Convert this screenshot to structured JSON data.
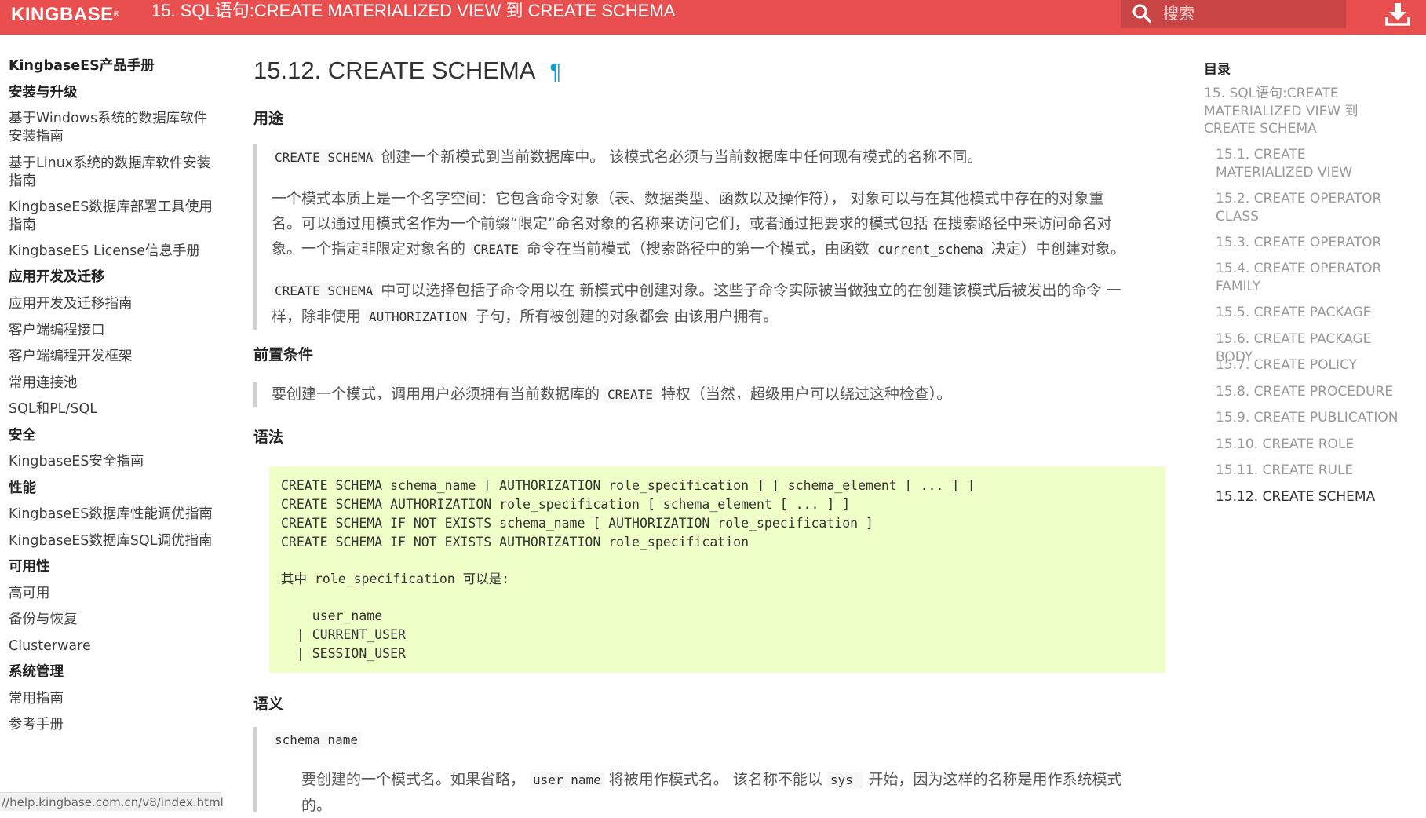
{
  "topbar": {
    "logo": "KINGBASE",
    "logo_mark": "®",
    "title": "15. SQL语句:CREATE MATERIALIZED VIEW 到 CREATE SCHEMA",
    "search_placeholder": "搜索"
  },
  "sidebar": {
    "items": [
      {
        "label": "KingbaseES产品手册",
        "heading": true
      },
      {
        "label": "安装与升级",
        "heading": true
      },
      {
        "label": "基于Windows系统的数据库软件安装指南",
        "heading": false
      },
      {
        "label": "基于Linux系统的数据库软件安装指南",
        "heading": false
      },
      {
        "label": "KingbaseES数据库部署工具使用指南",
        "heading": false
      },
      {
        "label": "KingbaseES License信息手册",
        "heading": false
      },
      {
        "label": "应用开发及迁移",
        "heading": true
      },
      {
        "label": "应用开发及迁移指南",
        "heading": false
      },
      {
        "label": "客户端编程接口",
        "heading": false
      },
      {
        "label": "客户端编程开发框架",
        "heading": false
      },
      {
        "label": "常用连接池",
        "heading": false
      },
      {
        "label": "SQL和PL/SQL",
        "heading": false
      },
      {
        "label": "安全",
        "heading": true
      },
      {
        "label": "KingbaseES安全指南",
        "heading": false
      },
      {
        "label": "性能",
        "heading": true
      },
      {
        "label": "KingbaseES数据库性能调优指南",
        "heading": false
      },
      {
        "label": "KingbaseES数据库SQL调优指南",
        "heading": false
      },
      {
        "label": "可用性",
        "heading": true
      },
      {
        "label": "高可用",
        "heading": false
      },
      {
        "label": "备份与恢复",
        "heading": false
      },
      {
        "label": "Clusterware",
        "heading": false
      },
      {
        "label": "系统管理",
        "heading": true
      },
      {
        "label": "常用指南",
        "heading": false
      },
      {
        "label": "参考手册",
        "heading": false
      }
    ]
  },
  "status_url": "//help.kingbase.com.cn/v8/index.html",
  "main": {
    "title": "15.12. CREATE SCHEMA",
    "anchor": "¶",
    "purpose": {
      "heading": "用途",
      "p1": {
        "code": "CREATE SCHEMA",
        "text": " 创建一个新模式到当前数据库中。 该模式名必须与当前数据库中任何现有模式的名称不同。"
      },
      "p2": {
        "line1": "一个模式本质上是一个名字空间：它包含命令对象（表、数据类型、函数以及操作符）， 对象可以与在其他模式中存在的对象重",
        "line2": "名。可以通过用模式名作为一个前缀“限定”命名对象的名称来访问它们，或者通过把要求的模式包括 在搜索路径中来访问命名对",
        "l3a": "象。一个指定非限定对象名的 ",
        "l3code1": "CREATE",
        "l3b": " 命令在当前模式（搜索路径中的第一个模式，由函数 ",
        "l3code2": "current_schema",
        "l3c": " 决定）中创建对象。"
      },
      "p3": {
        "code1": "CREATE SCHEMA",
        "l1": " 中可以选择包括子命令用以在 新模式中创建对象。这些子命令实际被当做独立的在创建该模式后被发出的命令 一",
        "l2a": "样，除非使用 ",
        "code2": "AUTHORIZATION",
        "l2b": " 子句，所有被创建的对象都会 由该用户拥有。"
      }
    },
    "prereq": {
      "heading": "前置条件",
      "a": "要创建一个模式，调用用户必须拥有当前数据库的 ",
      "code": "CREATE",
      "b": " 特权（当然，超级用户可以绕过这种检查）。"
    },
    "syntax": {
      "heading": "语法",
      "lines": [
        "CREATE SCHEMA schema_name [ AUTHORIZATION role_specification ] [ schema_element [ ... ] ]",
        "CREATE SCHEMA AUTHORIZATION role_specification [ schema_element [ ... ] ]",
        "CREATE SCHEMA IF NOT EXISTS schema_name [ AUTHORIZATION role_specification ]",
        "CREATE SCHEMA IF NOT EXISTS AUTHORIZATION role_specification",
        "",
        "其中 role_specification 可以是:",
        "",
        "    user_name",
        "  | CURRENT_USER",
        "  | SESSION_USER"
      ]
    },
    "semantics": {
      "heading": "语义",
      "term": "schema_name",
      "a": "要创建的一个模式名。如果省略， ",
      "code1": "user_name",
      "b": " 将被用作模式名。 该名称不能以 ",
      "code2": "sys_",
      "c": " 开始，因为这样的名称是用作系统模式",
      "d": "的。"
    }
  },
  "toc": {
    "title": "目录",
    "entries": [
      {
        "label": "15. SQL语句:CREATE MATERIALIZED VIEW 到 CREATE SCHEMA",
        "level": 0
      },
      {
        "label": "15.1. CREATE MATERIALIZED VIEW",
        "level": 1
      },
      {
        "label": "15.2. CREATE OPERATOR CLASS",
        "level": 1
      },
      {
        "label": "15.3. CREATE OPERATOR",
        "level": 1
      },
      {
        "label": "15.4. CREATE OPERATOR FAMILY",
        "level": 1
      },
      {
        "label": "15.5. CREATE PACKAGE",
        "level": 1
      },
      {
        "label": "15.6. CREATE PACKAGE BODY",
        "level": 1
      },
      {
        "label": "15.7. CREATE POLICY",
        "level": 1
      },
      {
        "label": "15.8. CREATE PROCEDURE",
        "level": 1
      },
      {
        "label": "15.9. CREATE PUBLICATION",
        "level": 1
      },
      {
        "label": "15.10. CREATE ROLE",
        "level": 1
      },
      {
        "label": "15.11. CREATE RULE",
        "level": 1
      },
      {
        "label": "15.12. CREATE SCHEMA",
        "level": 1,
        "active": true
      }
    ]
  },
  "colors": {
    "brand": "#e94f4f",
    "syntax_bg": "#efffc8",
    "anchor": "#12a0c8"
  }
}
